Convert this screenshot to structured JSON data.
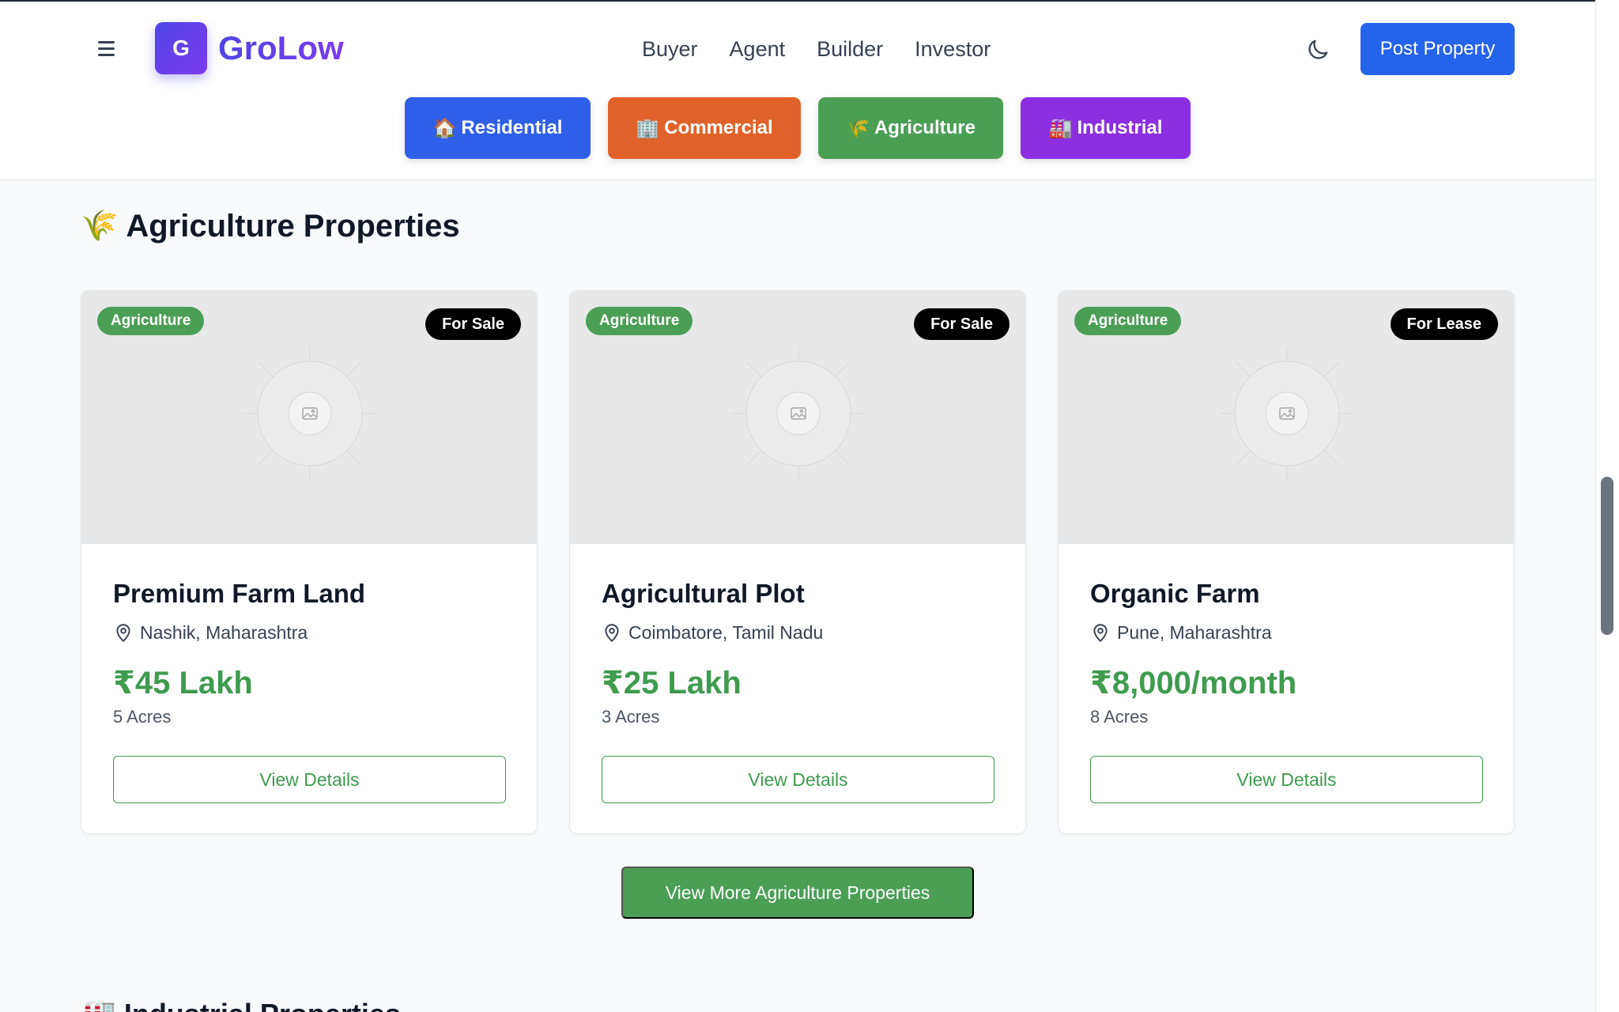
{
  "brand": {
    "initial": "G",
    "name": "GroLow"
  },
  "nav": [
    "Buyer",
    "Agent",
    "Builder",
    "Investor"
  ],
  "header": {
    "post_label": "Post Property"
  },
  "categories": [
    {
      "icon": "🏠",
      "label": "Residential"
    },
    {
      "icon": "🏢",
      "label": "Commercial"
    },
    {
      "icon": "🌾",
      "label": "Agriculture"
    },
    {
      "icon": "🏭",
      "label": "Industrial"
    }
  ],
  "section": {
    "icon": "🌾",
    "title": "Agriculture Properties"
  },
  "cards": [
    {
      "type": "Agriculture",
      "status": "For Sale",
      "title": "Premium Farm Land",
      "location": "Nashik, Maharashtra",
      "price": "₹45 Lakh",
      "area": "5 Acres",
      "button": "View Details"
    },
    {
      "type": "Agriculture",
      "status": "For Sale",
      "title": "Agricultural Plot",
      "location": "Coimbatore, Tamil Nadu",
      "price": "₹25 Lakh",
      "area": "3 Acres",
      "button": "View Details"
    },
    {
      "type": "Agriculture",
      "status": "For Lease",
      "title": "Organic Farm",
      "location": "Pune, Maharashtra",
      "price": "₹8,000/month",
      "area": "8 Acres",
      "button": "View Details"
    }
  ],
  "more_button": "View More Agriculture Properties",
  "next_section": {
    "icon": "🏭",
    "title": "Industrial Properties"
  },
  "colors": {
    "primary": "#2563eb",
    "agriculture": "#4a9f55",
    "commercial": "#e0622a",
    "industrial": "#8b2fe0",
    "brand_from": "#4f46e5",
    "brand_to": "#7c3aed"
  }
}
